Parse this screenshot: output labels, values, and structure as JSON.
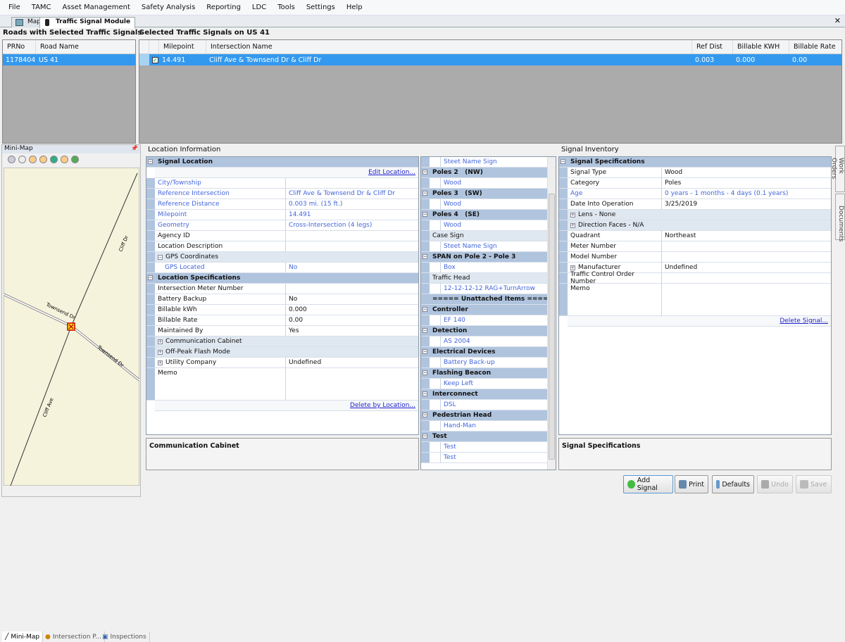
{
  "menu": [
    "File",
    "TAMC",
    "Asset Management",
    "Safety Analysis",
    "Reporting",
    "LDC",
    "Tools",
    "Settings",
    "Help"
  ],
  "tabs": [
    {
      "label": "Map",
      "active": false
    },
    {
      "label": "Traffic Signal Module",
      "active": true
    }
  ],
  "roads": {
    "title": "Roads with Selected Traffic Signals",
    "columns": [
      "PRNo",
      "Road Name"
    ],
    "rows": [
      [
        "1178404",
        "US 41"
      ]
    ]
  },
  "signals": {
    "title": "Selected Traffic Signals on US 41",
    "columns": [
      "",
      "Milepoint",
      "Intersection Name",
      "Ref Dist",
      "Billable KWH",
      "Billable Rate"
    ],
    "rows": [
      {
        "checked": true,
        "milepoint": "14.491",
        "name": "Cliff Ave & Townsend Dr & Cliff Dr",
        "ref_dist": "0.003",
        "kwh": "0.000",
        "rate": "0.00"
      }
    ]
  },
  "minimap": {
    "title": "Mini-Map",
    "toolbar": [
      "select-icon",
      "pan-hand-icon",
      "zoom-icon",
      "zoom-in-icon",
      "globe-icon",
      "zoom-out-icon",
      "full-extent-icon"
    ],
    "road_labels": [
      "Cliff Dr",
      "Townsend Dr",
      "Townsend Dr",
      "Cliff Ave"
    ],
    "bottom_tabs": [
      "Mini-Map",
      "Intersection P...",
      "Inspections"
    ]
  },
  "location": {
    "title": "Location Information",
    "rows": [
      {
        "t": "hdr",
        "label": "Signal Location"
      },
      {
        "t": "link",
        "label": "Edit Location..."
      },
      {
        "label": "City/Township",
        "value": "",
        "blue": true
      },
      {
        "label": "Reference Intersection",
        "value": "Cliff Ave & Townsend Dr & Cliff Dr",
        "blue": true
      },
      {
        "label": "Reference Distance",
        "value": "0.003 mi. (15 ft.)",
        "blue": true
      },
      {
        "label": "Milepoint",
        "value": "14.491",
        "blue": true
      },
      {
        "label": "Geometry",
        "value": "Cross-Intersection (4 legs)",
        "blue": true
      },
      {
        "label": "Agency ID",
        "value": ""
      },
      {
        "label": "Location Description",
        "value": ""
      },
      {
        "t": "sub",
        "label": "GPS Coordinates",
        "pm": "-"
      },
      {
        "label": "GPS Located",
        "value": "No",
        "blue": true,
        "indent": true
      },
      {
        "t": "hdr",
        "label": "Location Specifications"
      },
      {
        "label": "Intersection Meter Number",
        "value": ""
      },
      {
        "label": "Battery Backup",
        "value": "No"
      },
      {
        "label": "Billable kWh",
        "value": "0.000"
      },
      {
        "label": "Billable Rate",
        "value": "0.00"
      },
      {
        "label": "Maintained By",
        "value": "Yes"
      },
      {
        "t": "sub",
        "label": "Communication Cabinet",
        "pm": "+"
      },
      {
        "t": "sub",
        "label": "Off-Peak Flash Mode",
        "pm": "+"
      },
      {
        "label": "Utility Company",
        "value": "Undefined",
        "pm": "+"
      },
      {
        "label": "Memo",
        "value": "",
        "tall": true
      },
      {
        "t": "link",
        "label": "Delete by Location..."
      }
    ],
    "detail_title": "Communication Cabinet"
  },
  "tree": [
    {
      "t": "item",
      "label": "Steet Name Sign"
    },
    {
      "t": "hdr",
      "label": "Poles 2   (NW)"
    },
    {
      "t": "item",
      "label": "Wood"
    },
    {
      "t": "hdr",
      "label": "Poles 3   (SW)"
    },
    {
      "t": "item",
      "label": "Wood"
    },
    {
      "t": "hdr",
      "label": "Poles 4   (SE)"
    },
    {
      "t": "item",
      "label": "Wood"
    },
    {
      "t": "sub",
      "label": "Case Sign"
    },
    {
      "t": "item",
      "label": "Steet Name Sign"
    },
    {
      "t": "hdr",
      "label": "SPAN on Pole 2 - Pole 3"
    },
    {
      "t": "item",
      "label": "Box"
    },
    {
      "t": "sub",
      "label": "Traffic Head"
    },
    {
      "t": "item",
      "label": "12-12-12-12 RAG+TurnArrow"
    },
    {
      "t": "sep",
      "label": "===== Unattached Items ====="
    },
    {
      "t": "hdr",
      "label": "Controller"
    },
    {
      "t": "item",
      "label": "EF 140"
    },
    {
      "t": "hdr",
      "label": "Detection"
    },
    {
      "t": "item",
      "label": "AS 2004"
    },
    {
      "t": "hdr",
      "label": "Electrical Devices"
    },
    {
      "t": "item",
      "label": "Battery Back-up"
    },
    {
      "t": "hdr",
      "label": "Flashing Beacon"
    },
    {
      "t": "item",
      "label": "Keep Left"
    },
    {
      "t": "hdr",
      "label": "Interconnect"
    },
    {
      "t": "item",
      "label": "DSL"
    },
    {
      "t": "hdr",
      "label": "Pedestrian Head"
    },
    {
      "t": "item",
      "label": "Hand-Man"
    },
    {
      "t": "hdr",
      "label": "Test"
    },
    {
      "t": "item",
      "label": "Test"
    },
    {
      "t": "item",
      "label": "Test"
    }
  ],
  "inventory": {
    "title": "Signal Inventory",
    "rows": [
      {
        "t": "hdr",
        "label": "Signal Specifications"
      },
      {
        "label": "Signal Type",
        "value": "Wood"
      },
      {
        "label": "Category",
        "value": "Poles"
      },
      {
        "label": "Age",
        "value": "0 years - 1 months - 4 days     (0.1 years)",
        "blue": true
      },
      {
        "label": "Date Into Operation",
        "value": "3/25/2019"
      },
      {
        "t": "sub",
        "label": "Lens - None",
        "pm": "+"
      },
      {
        "t": "sub",
        "label": "Direction Faces - N/A",
        "pm": "+"
      },
      {
        "label": "Quadrant",
        "value": "Northeast"
      },
      {
        "label": "Meter Number",
        "value": ""
      },
      {
        "label": "Model Number",
        "value": ""
      },
      {
        "label": "Manufacturer",
        "value": "Undefined",
        "pm": "+"
      },
      {
        "label": "Traffic Control Order Number",
        "value": ""
      },
      {
        "label": "Memo",
        "value": "",
        "tall": true
      },
      {
        "t": "link",
        "label": "Delete Signal..."
      }
    ],
    "detail_title": "Signal Specifications"
  },
  "side_tabs": [
    "Work Orders",
    "Documents"
  ],
  "buttons": [
    {
      "label": "Add Signal",
      "enabled": true,
      "icon": "add-icon"
    },
    {
      "label": "Print",
      "enabled": true,
      "icon": "print-icon"
    },
    {
      "label": "Defaults",
      "enabled": true,
      "icon": "defaults-icon"
    },
    {
      "label": "Undo",
      "enabled": false,
      "icon": "undo-icon"
    },
    {
      "label": "Save",
      "enabled": false,
      "icon": "save-icon"
    }
  ]
}
